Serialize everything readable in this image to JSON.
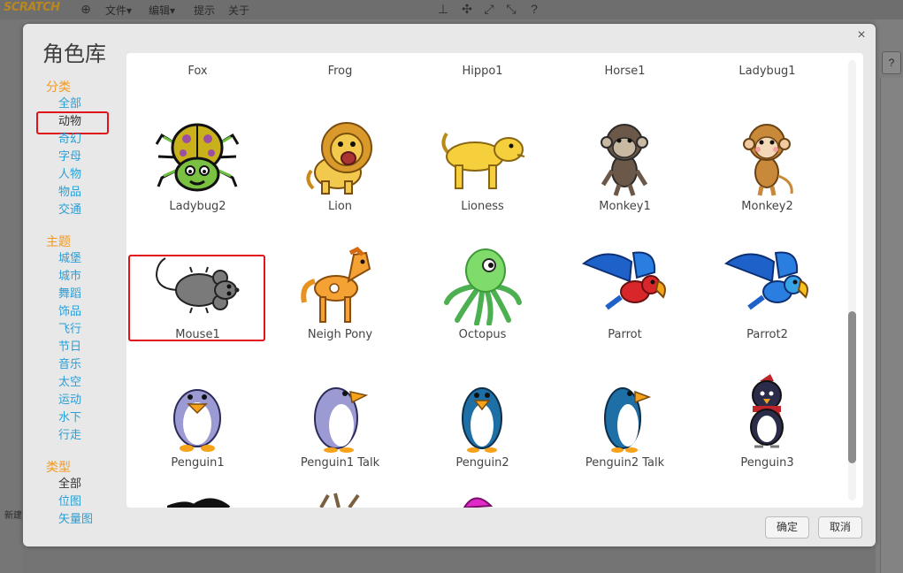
{
  "menubar": {
    "logo": "SCRATCH",
    "file": "文件▾",
    "edit": "编辑▾",
    "tips": "提示",
    "about": "关于"
  },
  "background": {
    "new_label": "新建",
    "help": "?"
  },
  "dialog": {
    "title": "角色库",
    "close": "×",
    "ok": "确定",
    "cancel": "取消"
  },
  "sidebar": {
    "category_title": "分类",
    "categories": [
      "全部",
      "动物",
      "奇幻",
      "字母",
      "人物",
      "物品",
      "交通"
    ],
    "selected_category": "动物",
    "theme_title": "主题",
    "themes": [
      "城堡",
      "城市",
      "舞蹈",
      "饰品",
      "飞行",
      "节日",
      "音乐",
      "太空",
      "运动",
      "水下",
      "行走"
    ],
    "type_title": "类型",
    "types": [
      "全部",
      "位图",
      "矢量图"
    ],
    "selected_type": "全部"
  },
  "library": {
    "top_row": [
      "Fox",
      "Frog",
      "Hippo1",
      "Horse1",
      "Ladybug1"
    ],
    "row1": [
      "Ladybug2",
      "Lion",
      "Lioness",
      "Monkey1",
      "Monkey2"
    ],
    "row2": [
      "Mouse1",
      "Neigh Pony",
      "Octopus",
      "Parrot",
      "Parrot2"
    ],
    "row3": [
      "Penguin1",
      "Penguin1 Talk",
      "Penguin2",
      "Penguin2 Talk",
      "Penguin3"
    ],
    "highlighted": "Mouse1"
  },
  "colors": {
    "accent_orange": "#f39a1e",
    "link_blue": "#2a9fd6",
    "highlight_red": "#e0121b"
  }
}
